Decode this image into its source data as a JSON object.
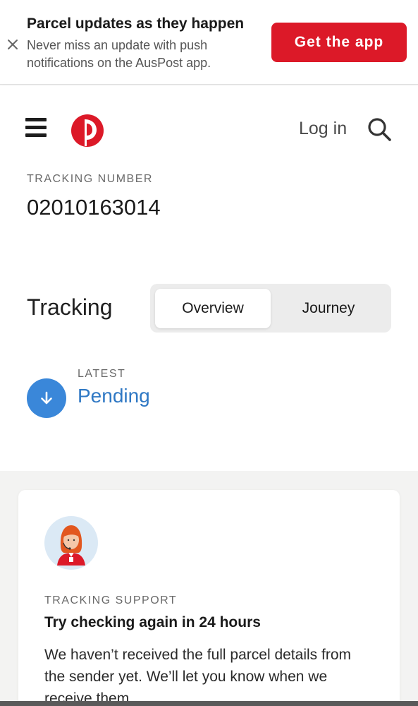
{
  "banner": {
    "title": "Parcel updates as they happen",
    "description": "Never miss an update with push notifications on the AusPost app.",
    "cta_label": "Get the app",
    "close_icon": "close-icon",
    "cta_color": "#dc1928"
  },
  "header": {
    "menu_icon": "hamburger-menu-icon",
    "logo": "auspost-logo",
    "login_label": "Log in",
    "search_icon": "search-icon",
    "brand_color": "#dc1928"
  },
  "tracking": {
    "number_label": "TRACKING NUMBER",
    "number_value": "02010163014",
    "heading": "Tracking",
    "tabs": [
      {
        "label": "Overview",
        "selected": true
      },
      {
        "label": "Journey",
        "selected": false
      }
    ],
    "status": {
      "latest_label": "LATEST",
      "value": "Pending",
      "icon": "arrow-down-icon",
      "color": "#2f78c4"
    }
  },
  "support": {
    "label": "TRACKING SUPPORT",
    "title": "Try checking again in 24 hours",
    "body": "We haven’t received the full parcel details from the sender yet. We’ll let you know when we receive them.",
    "avatar": "support-agent-avatar"
  }
}
